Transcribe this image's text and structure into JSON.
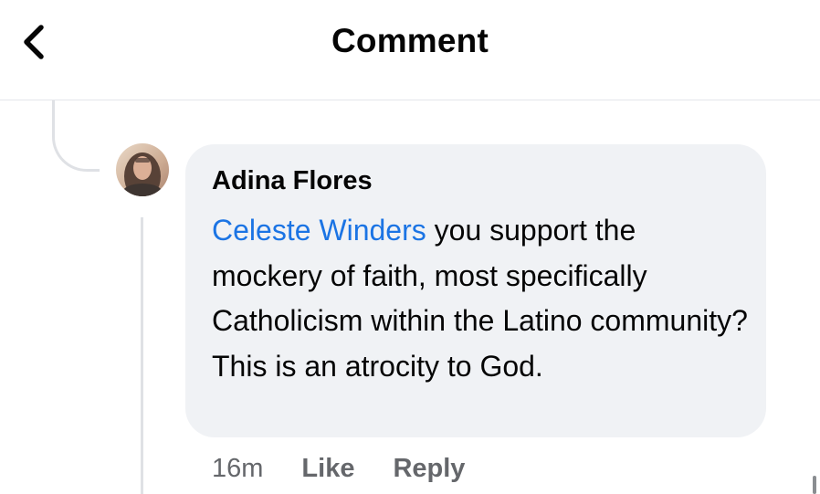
{
  "header": {
    "title": "Comment",
    "back_icon": "chevron-left-icon"
  },
  "comment": {
    "author": "Adina Flores",
    "avatar_icon": "user-avatar-photo",
    "mention": "Celeste Winders",
    "text": " you support the mockery of faith, most specifically Catholicism within the Latino community? This is an atrocity to God.",
    "timestamp": "16m",
    "like_label": "Like",
    "reply_label": "Reply"
  },
  "colors": {
    "mention": "#1b74e4",
    "bubble": "#f0f2f5",
    "secondary_text": "#65676b",
    "thread_line": "#dfe1e5"
  }
}
